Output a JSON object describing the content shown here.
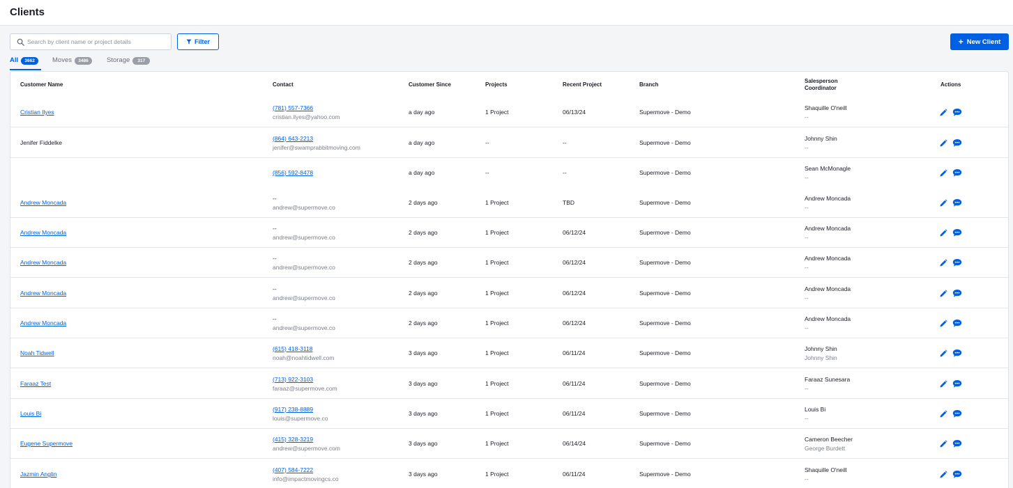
{
  "header": {
    "title": "Clients"
  },
  "search": {
    "placeholder": "Search by client name or project details",
    "value": ""
  },
  "toolbar": {
    "filter_label": "Filter",
    "new_client_label": "New Client"
  },
  "tabs": [
    {
      "label": "All",
      "count": "3662",
      "active": true
    },
    {
      "label": "Moves",
      "count": "3486",
      "active": false
    },
    {
      "label": "Storage",
      "count": "317",
      "active": false
    }
  ],
  "columns": {
    "customer_name": "Customer Name",
    "contact": "Contact",
    "customer_since": "Customer Since",
    "projects": "Projects",
    "recent_project": "Recent Project",
    "branch": "Branch",
    "salesperson": "Salesperson",
    "coordinator": "Coordinator",
    "actions": "Actions"
  },
  "colors": {
    "accent": "#0060e3",
    "badge_inactive": "#9a9ea6",
    "text": "#1b1e26",
    "muted": "#7a7f88"
  },
  "icons": {
    "search": "search-icon",
    "filter": "filter-icon",
    "plus": "plus-icon",
    "edit": "pencil-icon",
    "message": "chat-icon"
  },
  "rows": [
    {
      "name": "Cristian Ilyes",
      "name_link": true,
      "phone": "(781) 557-7366",
      "email": "cristian.ilyes@yahoo.com",
      "since": "a day ago",
      "projects": "1 Project",
      "recent": "06/13/24",
      "branch": "Supermove - Demo",
      "salesperson": "Shaquille O'neill",
      "coordinator": "--"
    },
    {
      "name": "Jenifer Fiddelke",
      "name_link": false,
      "phone": "(864) 643-2213",
      "email": "jenifer@swamprabbitmoving.com",
      "since": "a day ago",
      "projects": "--",
      "recent": "--",
      "branch": "Supermove - Demo",
      "salesperson": "Johnny Shin",
      "coordinator": "--"
    },
    {
      "name": "",
      "name_link": false,
      "phone": "(856) 592-8478",
      "email": "",
      "since": "a day ago",
      "projects": "--",
      "recent": "--",
      "branch": "Supermove - Demo",
      "salesperson": "Sean McMonagle",
      "coordinator": "--"
    },
    {
      "name": "Andrew Moncada",
      "name_link": true,
      "phone": "--",
      "phone_link": false,
      "email": "andrew@supermove.co",
      "since": "2 days ago",
      "projects": "1 Project",
      "recent": "TBD",
      "branch": "Supermove - Demo",
      "salesperson": "Andrew Moncada",
      "coordinator": "--"
    },
    {
      "name": "Andrew Moncada",
      "name_link": true,
      "phone": "--",
      "phone_link": false,
      "email": "andrew@supermove.co",
      "since": "2 days ago",
      "projects": "1 Project",
      "recent": "06/12/24",
      "branch": "Supermove - Demo",
      "salesperson": "Andrew Moncada",
      "coordinator": "--"
    },
    {
      "name": "Andrew Moncada",
      "name_link": true,
      "phone": "--",
      "phone_link": false,
      "email": "andrew@supermove.co",
      "since": "2 days ago",
      "projects": "1 Project",
      "recent": "06/12/24",
      "branch": "Supermove - Demo",
      "salesperson": "Andrew Moncada",
      "coordinator": "--"
    },
    {
      "name": "Andrew Moncada",
      "name_link": true,
      "phone": "--",
      "phone_link": false,
      "email": "andrew@supermove.co",
      "since": "2 days ago",
      "projects": "1 Project",
      "recent": "06/12/24",
      "branch": "Supermove - Demo",
      "salesperson": "Andrew Moncada",
      "coordinator": "--"
    },
    {
      "name": "Andrew Moncada",
      "name_link": true,
      "phone": "--",
      "phone_link": false,
      "email": "andrew@supermove.co",
      "since": "2 days ago",
      "projects": "1 Project",
      "recent": "06/12/24",
      "branch": "Supermove - Demo",
      "salesperson": "Andrew Moncada",
      "coordinator": "--"
    },
    {
      "name": "Noah Tidwell",
      "name_link": true,
      "phone": "(615) 418-3118",
      "email": "noah@noahtidwell.com",
      "since": "3 days ago",
      "projects": "1 Project",
      "recent": "06/11/24",
      "branch": "Supermove - Demo",
      "salesperson": "Johnny Shin",
      "coordinator": "Johnny Shin"
    },
    {
      "name": "Faraaz Test",
      "name_link": true,
      "phone": "(713) 922-3103",
      "email": "faraaz@supermove.com",
      "since": "3 days ago",
      "projects": "1 Project",
      "recent": "06/11/24",
      "branch": "Supermove - Demo",
      "salesperson": "Faraaz Sunesara",
      "coordinator": "--"
    },
    {
      "name": "Louis Bi",
      "name_link": true,
      "phone": "(917) 238-8889",
      "email": "louis@supermove.co",
      "since": "3 days ago",
      "projects": "1 Project",
      "recent": "06/11/24",
      "branch": "Supermove - Demo",
      "salesperson": "Louis Bi",
      "coordinator": "--"
    },
    {
      "name": "Eugene Supermove",
      "name_link": true,
      "phone": "(415) 328-3219",
      "email": "andrew@supermove.com",
      "since": "3 days ago",
      "projects": "1 Project",
      "recent": "06/14/24",
      "branch": "Supermove - Demo",
      "salesperson": "Cameron Beecher",
      "coordinator": "George Burdett"
    },
    {
      "name": "Jazmin Anglin",
      "name_link": true,
      "phone": "(407) 584-7222",
      "email": "info@impactmovingcs.co",
      "since": "3 days ago",
      "projects": "1 Project",
      "recent": "06/11/24",
      "branch": "Supermove - Demo",
      "salesperson": "Shaquille O'neill",
      "coordinator": "--"
    }
  ]
}
